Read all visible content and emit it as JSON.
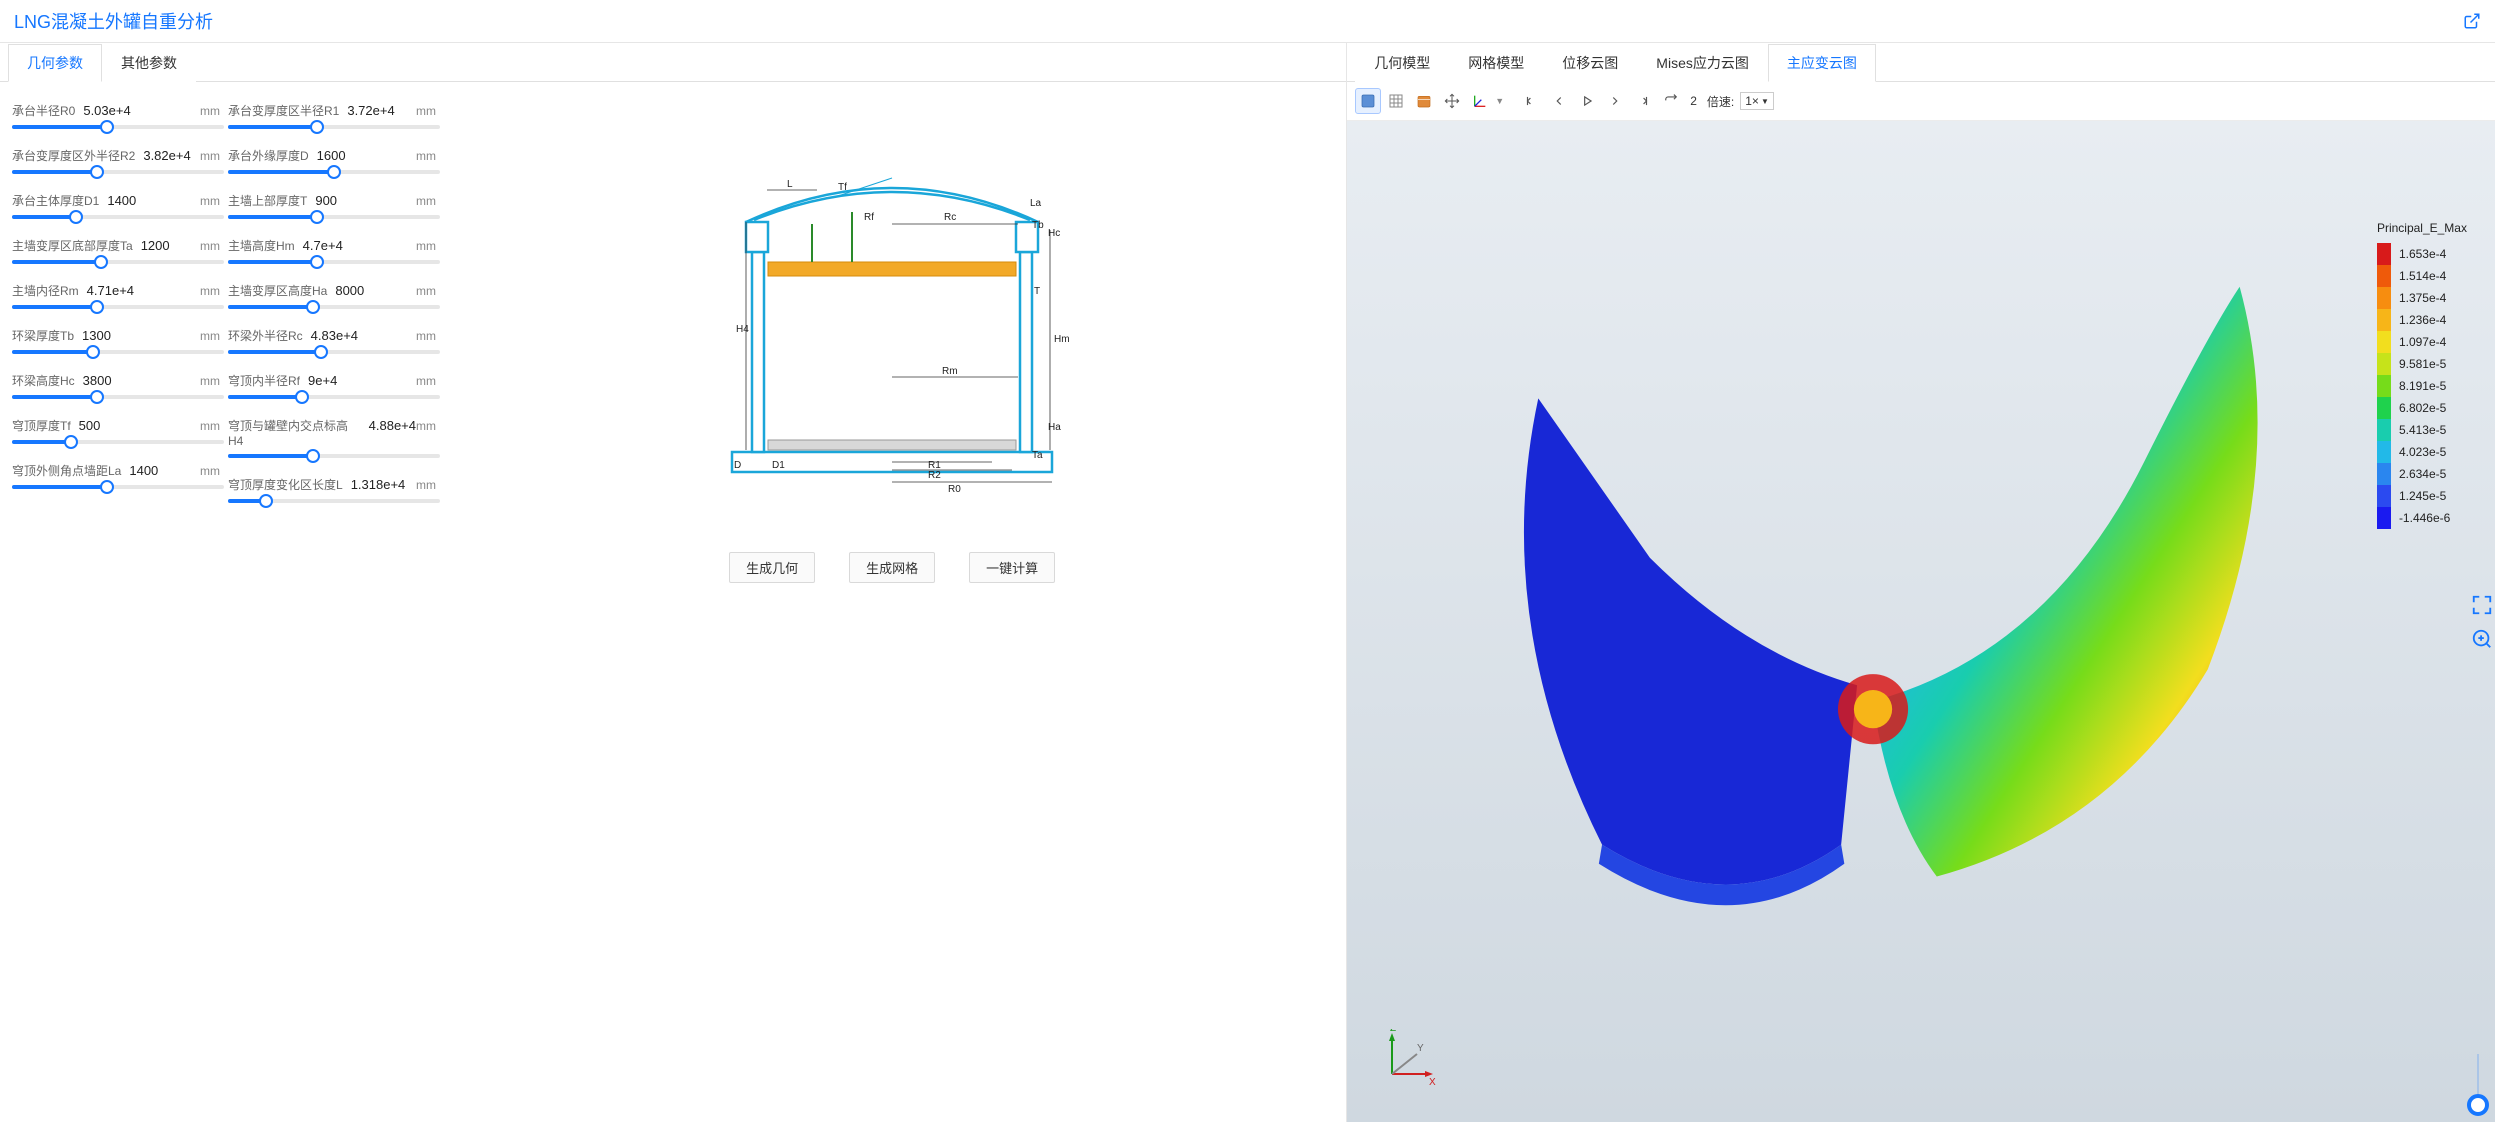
{
  "title": "LNG混凝土外罐自重分析",
  "leftTabs": [
    "几何参数",
    "其他参数"
  ],
  "leftActiveTab": 0,
  "rightTabs": [
    "几何模型",
    "网格模型",
    "位移云图",
    "Mises应力云图",
    "主应变云图"
  ],
  "rightActiveTab": 4,
  "unit": "mm",
  "params": {
    "col1": [
      {
        "name": "承台半径R0",
        "value": "5.03e+4",
        "pct": 45
      },
      {
        "name": "承台变厚度区外半径R2",
        "value": "3.82e+4",
        "pct": 40
      },
      {
        "name": "承台主体厚度D1",
        "value": "1400",
        "pct": 30
      },
      {
        "name": "主墙变厚区底部厚度Ta",
        "value": "1200",
        "pct": 42
      },
      {
        "name": "主墙内径Rm",
        "value": "4.71e+4",
        "pct": 40
      },
      {
        "name": "环梁厚度Tb",
        "value": "1300",
        "pct": 38
      },
      {
        "name": "环梁高度Hc",
        "value": "3800",
        "pct": 40
      },
      {
        "name": "穹顶厚度Tf",
        "value": "500",
        "pct": 28
      },
      {
        "name": "穹顶外侧角点墙距La",
        "value": "1400",
        "pct": 45
      }
    ],
    "col2": [
      {
        "name": "承台变厚度区半径R1",
        "value": "3.72e+4",
        "pct": 42
      },
      {
        "name": "承台外缘厚度D",
        "value": "1600",
        "pct": 50
      },
      {
        "name": "主墙上部厚度T",
        "value": "900",
        "pct": 42
      },
      {
        "name": "主墙高度Hm",
        "value": "4.7e+4",
        "pct": 42
      },
      {
        "name": "主墙变厚区高度Ha",
        "value": "8000",
        "pct": 40
      },
      {
        "name": "环梁外半径Rc",
        "value": "4.83e+4",
        "pct": 44
      },
      {
        "name": "穹顶内半径Rf",
        "value": "9e+4",
        "pct": 35
      },
      {
        "name": "穹顶与罐壁内交点标高H4",
        "value": "4.88e+4",
        "pct": 40
      },
      {
        "name": "穹顶厚度变化区长度L",
        "value": "1.318e+4",
        "pct": 18
      }
    ]
  },
  "diagramLabels": {
    "L": "L",
    "Tf": "Tf",
    "Rf": "Rf",
    "Rc": "Rc",
    "La": "La",
    "Tb": "Tb",
    "Hc": "Hc",
    "T": "T",
    "Hm": "Hm",
    "Rm": "Rm",
    "H4": "H4",
    "Ha": "Ha",
    "Ta": "Ta",
    "D": "D",
    "D1": "D1",
    "R1": "R1",
    "R2": "R2",
    "R0": "R0"
  },
  "buttons": {
    "genGeom": "生成几何",
    "genMesh": "生成网格",
    "oneClick": "一键计算"
  },
  "toolbar": {
    "frame": "2",
    "speedLabel": "倍速:",
    "speedValue": "1×"
  },
  "triad": {
    "x": "X",
    "y": "Y",
    "z": "Z"
  },
  "legend": {
    "title": "Principal_E_Max",
    "values": [
      "1.653e-4",
      "1.514e-4",
      "1.375e-4",
      "1.236e-4",
      "1.097e-4",
      "9.581e-5",
      "8.191e-5",
      "6.802e-5",
      "5.413e-5",
      "4.023e-5",
      "2.634e-5",
      "1.245e-5",
      "-1.446e-6"
    ],
    "colors": [
      "#d81a1a",
      "#ef5a0a",
      "#f78d0f",
      "#f7b518",
      "#f2de1e",
      "#c6e31a",
      "#76dc1a",
      "#1fd24d",
      "#19cdae",
      "#22b9e8",
      "#2a86ef",
      "#2b4af0",
      "#1a1af0"
    ]
  }
}
